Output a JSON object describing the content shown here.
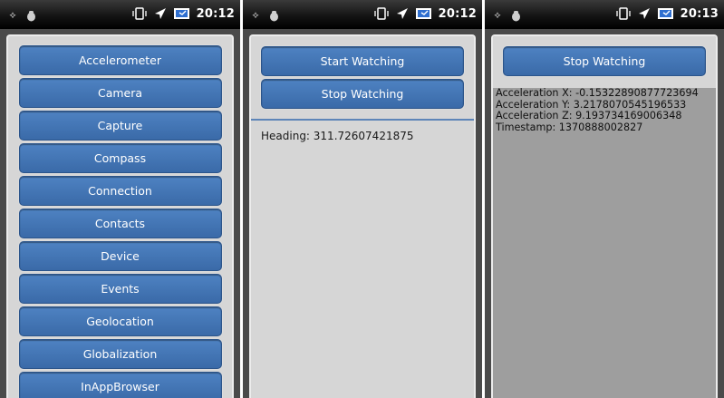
{
  "status_bar": {
    "icons": [
      "usb-debug-icon",
      "bug-icon",
      "vibrate-icon",
      "airplane-icon",
      "battery-icon"
    ]
  },
  "phones": [
    {
      "time": "20:12",
      "menu_items": [
        "Accelerometer",
        "Camera",
        "Capture",
        "Compass",
        "Connection",
        "Contacts",
        "Device",
        "Events",
        "Geolocation",
        "Globalization",
        "InAppBrowser"
      ]
    },
    {
      "time": "20:12",
      "start_label": "Start Watching",
      "stop_label": "Stop Watching",
      "heading_text": "Heading: 311.72607421875"
    },
    {
      "time": "20:13",
      "stop_label": "Stop Watching",
      "readings": [
        "Acceleration X: -0.15322890877723694",
        "Acceleration Y: 3.2178070545196533",
        "Acceleration Z: 9.193734169006348",
        "Timestamp: 1370888002827"
      ]
    }
  ],
  "colors": {
    "button": "#3f72b4",
    "screen_bg": "#d6d6d6",
    "status_bar": "#000000"
  }
}
